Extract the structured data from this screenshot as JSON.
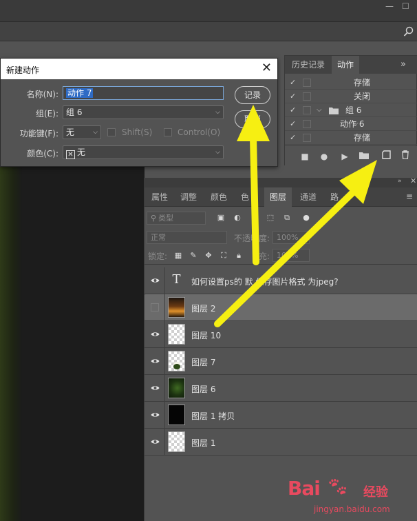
{
  "window": {
    "minimize": "—",
    "maximize": "☐"
  },
  "dialog": {
    "title": "新建动作",
    "close": "✕",
    "name_label": "名称(N):",
    "name_value": "动作 7",
    "group_label": "组(E):",
    "group_value": "组 6",
    "fkey_label": "功能键(F):",
    "fkey_value": "无",
    "shift_label": "Shift(S)",
    "control_label": "Control(O)",
    "color_label": "颜色(C):",
    "color_value": "无",
    "record_button": "记录",
    "cancel_button": "取消"
  },
  "actions_panel": {
    "tabs": [
      "历史记录",
      "动作"
    ],
    "active_tab": 1,
    "menu_glyph": "»",
    "rows": [
      {
        "name": "存储",
        "indent": 2,
        "checked": true
      },
      {
        "name": "关闭",
        "indent": 2,
        "checked": true
      },
      {
        "name": "组 6",
        "indent": 0,
        "checked": true,
        "folder": true,
        "expanded": true
      },
      {
        "name": "动作 6",
        "indent": 1,
        "checked": true,
        "expanded": true
      },
      {
        "name": "存储",
        "indent": 2,
        "checked": true
      }
    ]
  },
  "layers_panel": {
    "tabs": [
      "属性",
      "调整",
      "颜色",
      "色",
      "图层",
      "通道",
      "路"
    ],
    "active_tab": 4,
    "filter_label": "类型",
    "blend_mode": "正常",
    "opacity_label": "不透明度:",
    "opacity_value": "100%",
    "lock_label": "锁定:",
    "fill_label": "充:",
    "fill_value": "100%",
    "layers": [
      {
        "name": "如何设置ps的 默 保存图片格式 为jpeg?",
        "thumb": "text",
        "visible": true,
        "selected": false
      },
      {
        "name": "图层 2",
        "thumb": "sunset",
        "visible": false,
        "selected": true
      },
      {
        "name": "图层 10",
        "thumb": "transparent",
        "visible": true,
        "selected": false
      },
      {
        "name": "图层 7",
        "thumb": "flower",
        "visible": true,
        "selected": false
      },
      {
        "name": "图层 6",
        "thumb": "green",
        "visible": true,
        "selected": false
      },
      {
        "name": "图层 1 拷贝",
        "thumb": "black",
        "visible": true,
        "selected": false
      },
      {
        "name": "图层 1",
        "thumb": "transparent",
        "visible": true,
        "selected": false
      }
    ]
  },
  "watermark": {
    "logo": "Bai",
    "brand": "经验",
    "url": "jingyan.baidu.com"
  },
  "colors": {
    "arrow": "#f6ef12",
    "selection": "#2e6bc5",
    "panel": "#535353"
  }
}
